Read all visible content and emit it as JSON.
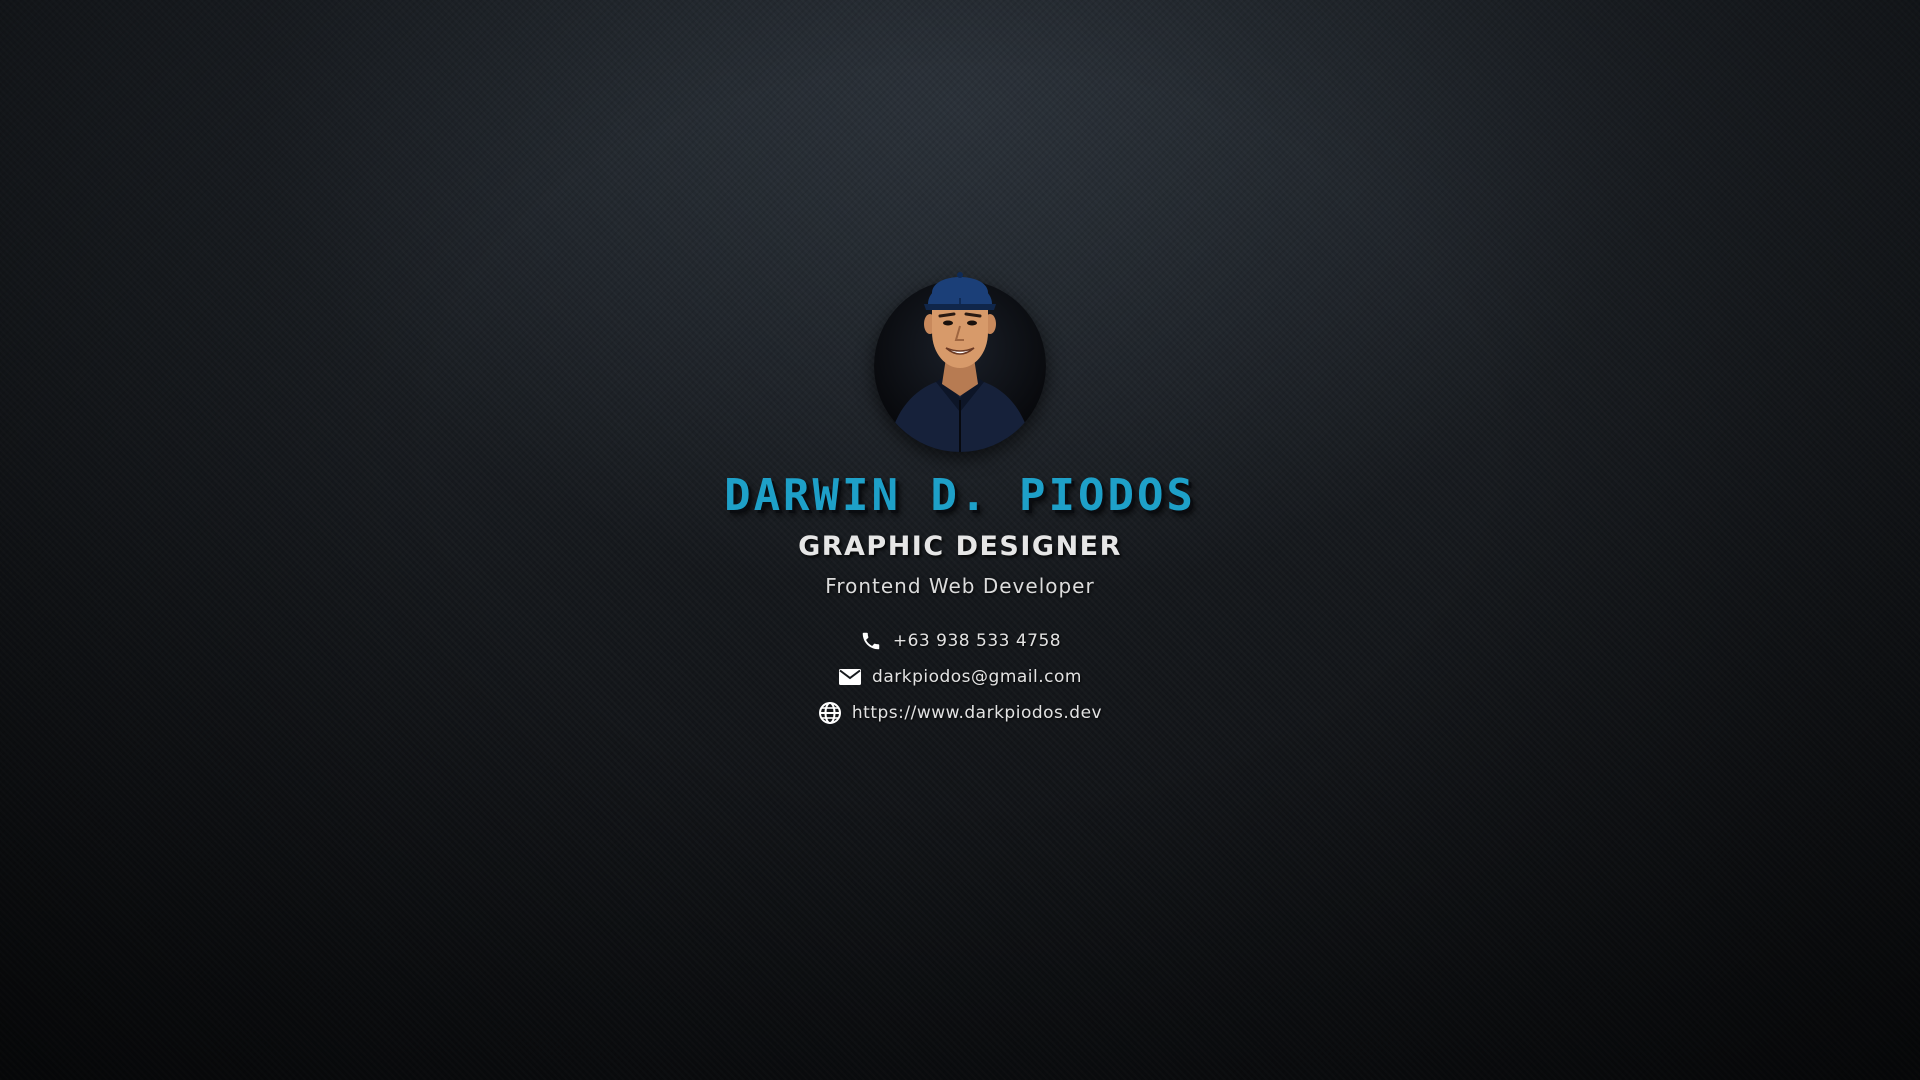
{
  "profile": {
    "name": "DARWIN D. PIODOS",
    "title": "GRAPHIC DESIGNER",
    "subtitle": "Frontend Web Developer"
  },
  "contacts": {
    "phone": {
      "icon": "phone-icon",
      "text": "+63 938 533 4758"
    },
    "email": {
      "icon": "mail-icon",
      "text": "darkpiodos@gmail.com"
    },
    "website": {
      "icon": "globe-icon",
      "text": "https://www.darkpiodos.dev"
    }
  },
  "colors": {
    "accent": "#1ea0c8",
    "background": "#15181c",
    "text": "#e2e2e2"
  }
}
